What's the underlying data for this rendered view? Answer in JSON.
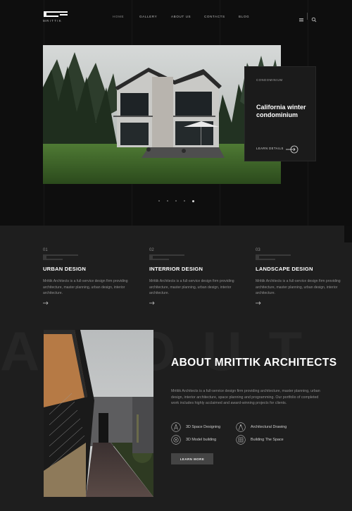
{
  "brand": {
    "logo_text": "MRITTIK"
  },
  "nav": [
    {
      "label": "HOME"
    },
    {
      "label": "GALLERY"
    },
    {
      "label": "ABOUT US"
    },
    {
      "label": "CONTACTS"
    },
    {
      "label": "BLOG"
    }
  ],
  "hero": {
    "card": {
      "eyebrow": "CONDOMINIUM",
      "title": "California winter condominium",
      "link_label": "LEARN DETAILS"
    },
    "slide_count": 5,
    "active_slide": 5
  },
  "services": [
    {
      "num": "01",
      "title": "URBAN DESIGN",
      "desc": "Mrittik Architects is a full-service design firm providing architecture, master planning, urban design, interior architecture."
    },
    {
      "num": "02",
      "title": "INTERRIOR DESIGN",
      "desc": "Mrittik Architects is a full-service design firm providing architecture, master planning, urban design, interior architecture."
    },
    {
      "num": "03",
      "title": "LANDSCAPE DESIGN",
      "desc": "Mrittik Architects is a full-service design firm providing architecture, master planning, urban design, interior architecture."
    }
  ],
  "about": {
    "watermark": "ABOUT",
    "title": "ABOUT MRITTIK ARCHITECTS",
    "text": "Mrittik Architects is a full-service design firm providing architecture, master planning, urban design, interior architecture, space planning and programming. Our portfolio of completed work includes highly acclaimed and award-winning projects for clients.",
    "features": [
      {
        "label": "3D Space Designing",
        "icon": "compass-icon"
      },
      {
        "label": "Architectural Drawing",
        "icon": "drafting-icon"
      },
      {
        "label": "3D Model building",
        "icon": "target-icon"
      },
      {
        "label": "Building The Space",
        "icon": "blueprint-icon"
      }
    ],
    "button_label": "LEARN MORE"
  },
  "colors": {
    "background": "#0f0f0f",
    "panel": "#1e1e1e",
    "card": "#1b1b1b",
    "button": "#444444"
  }
}
